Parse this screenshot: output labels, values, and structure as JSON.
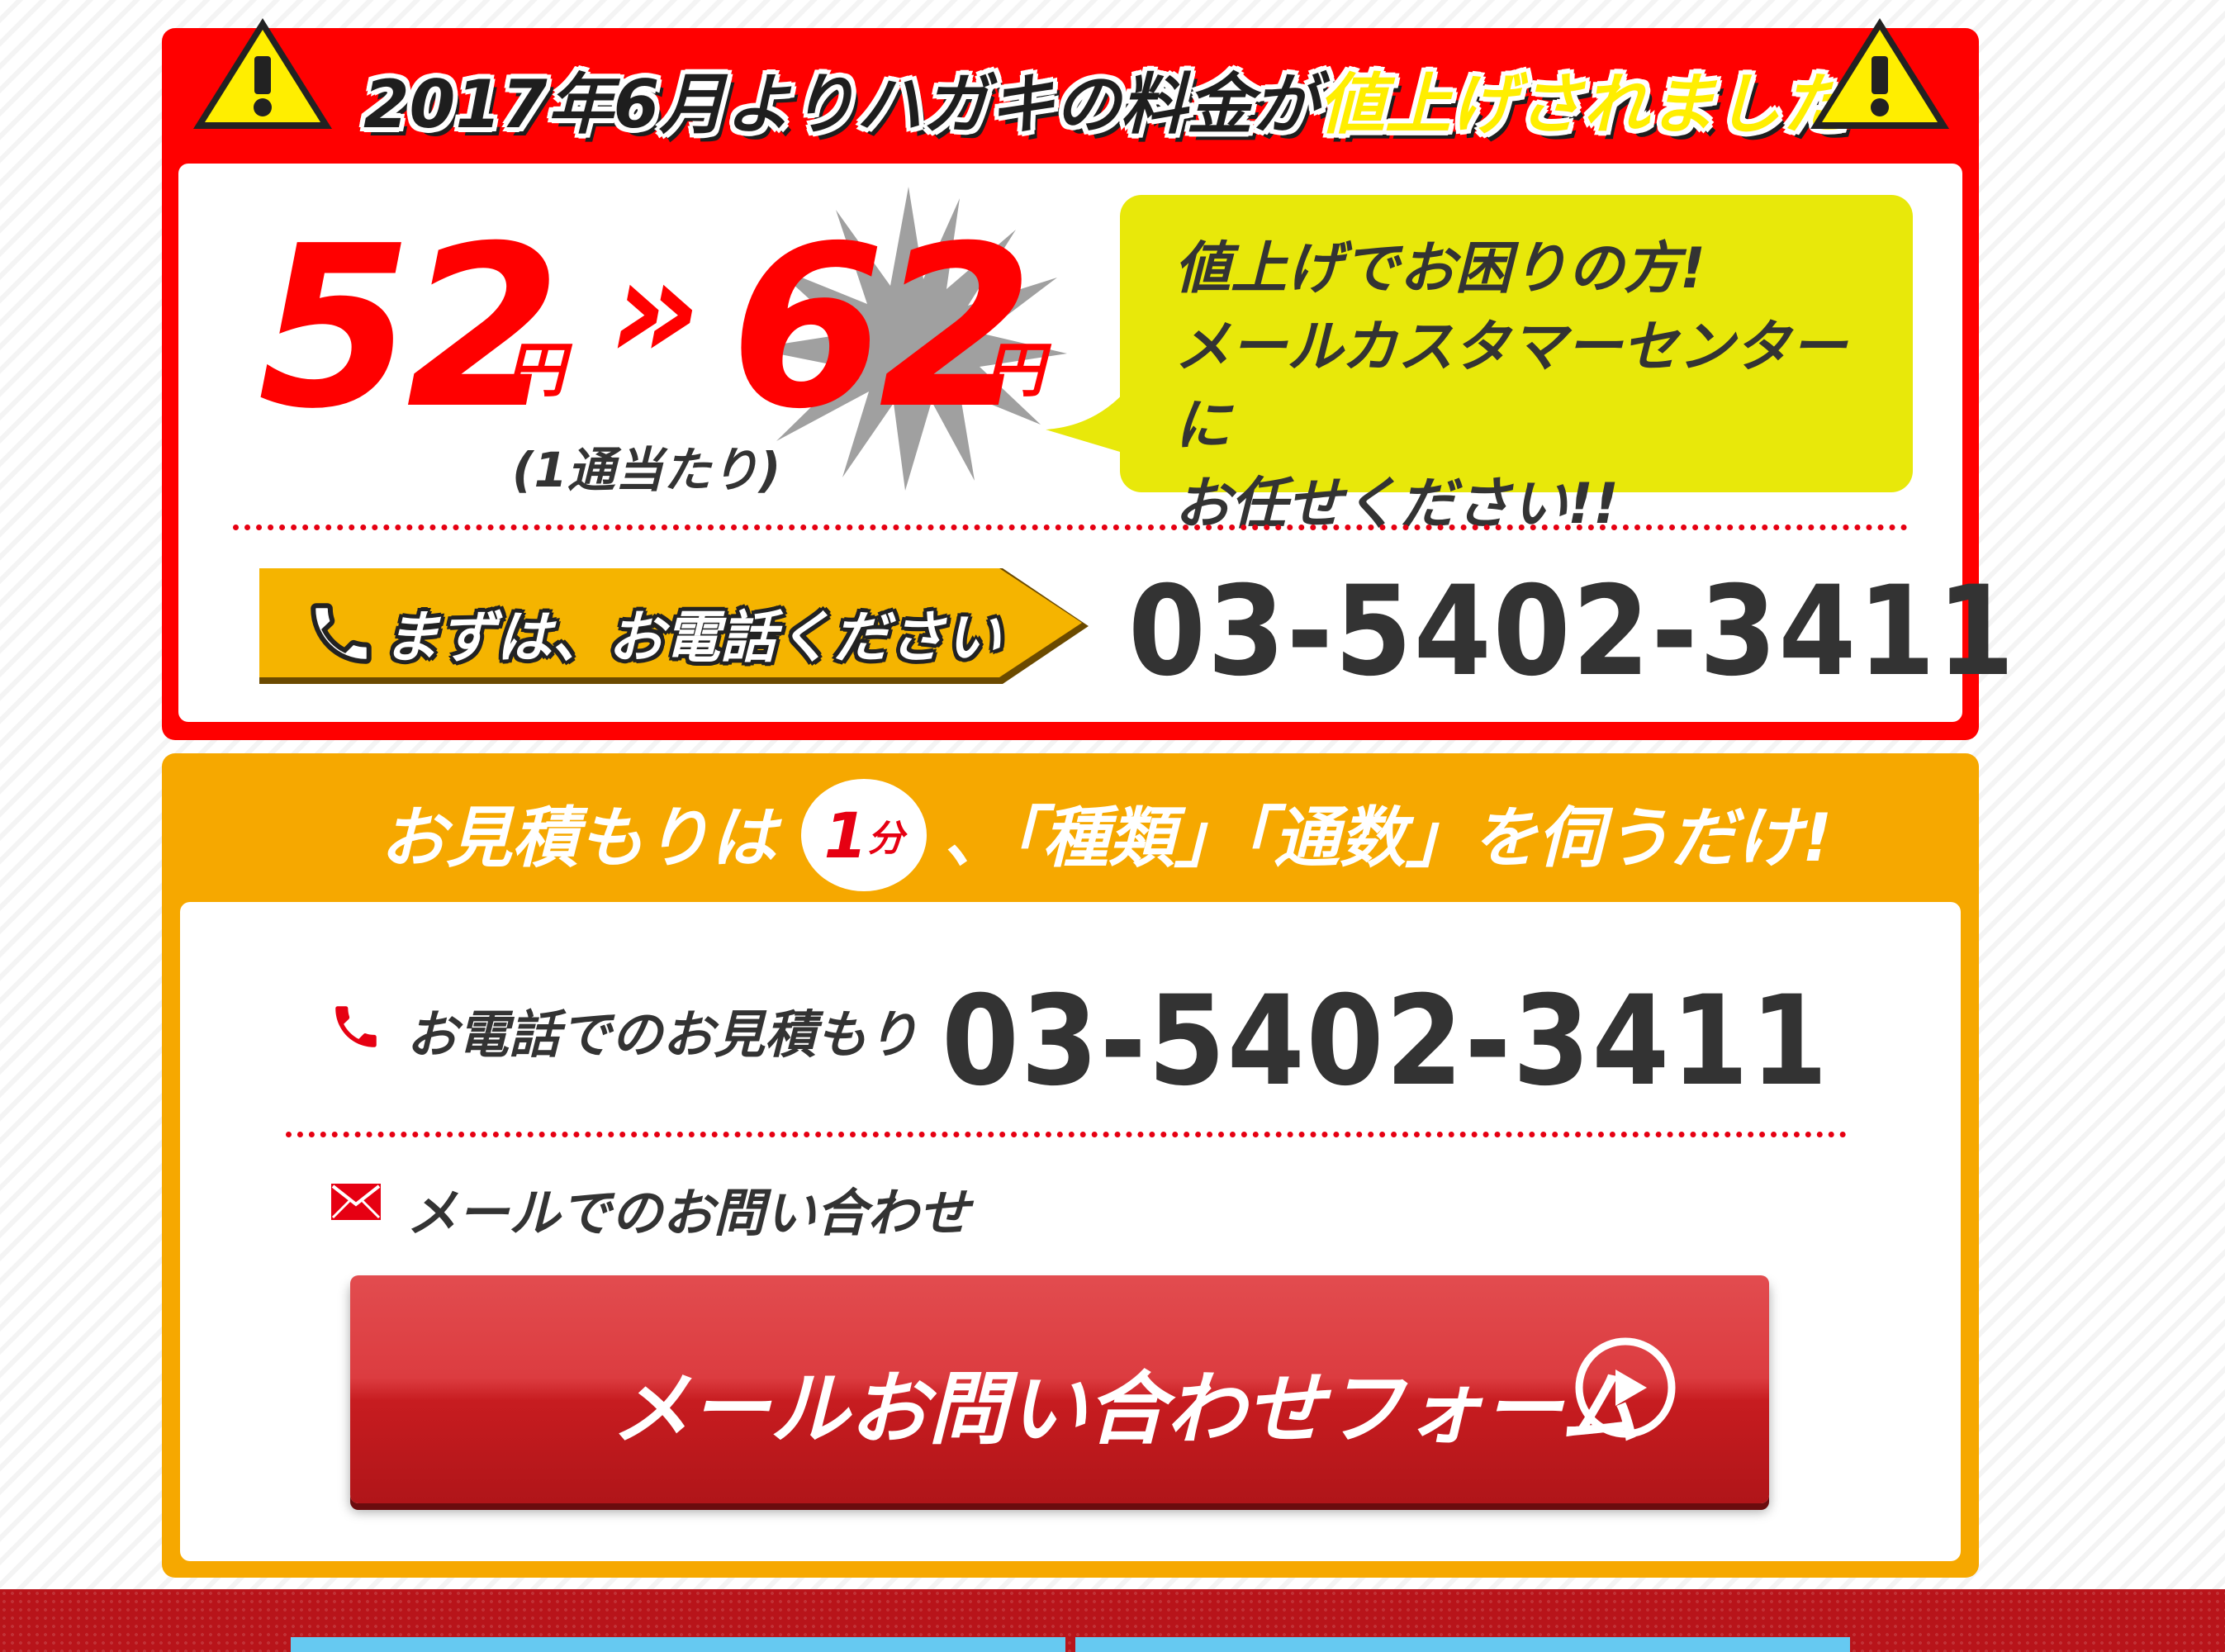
{
  "notice": {
    "title_prefix": "2017年6月よりハガキの料金が",
    "title_highlight": "値上げされました"
  },
  "price": {
    "old_value": "52",
    "new_value": "62",
    "yen_label": "円",
    "arrow": "»",
    "per_letter": "(1通当たり)"
  },
  "bubble": {
    "line1": "値上げでお困りの方!",
    "line2": "メールカスタマーセンターに",
    "line3": "お任せください!!"
  },
  "call": {
    "tag_text": "まずは、お電話ください",
    "phone": "03-5402-3411"
  },
  "estimate": {
    "header_left": "お見積もりは",
    "header_circle_number": "1",
    "header_circle_unit": "分",
    "header_right": "、「種類」「通数」を伺うだけ!",
    "tel_label": "お電話でのお見積もり",
    "tel_number": "03-5402-3411",
    "mail_label": "メールでのお問い合わせ",
    "mail_button_label": "メールお問い合わせフォーム"
  },
  "colors": {
    "brand_red": "#ff0000",
    "accent_orange": "#f6a800",
    "bubble_yellow": "#e8e80a",
    "button_red": "#d32f33",
    "footer_red": "#b8141a",
    "footer_tab_blue": "#66c9f1"
  },
  "icons": [
    "warning-triangle-icon",
    "phone-icon",
    "mail-icon",
    "play-circle-icon"
  ]
}
